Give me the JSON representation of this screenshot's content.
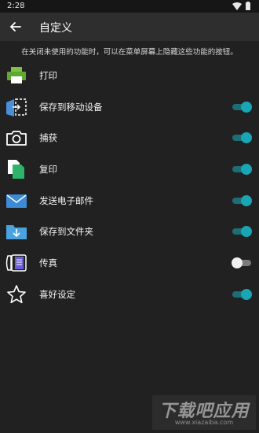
{
  "status_bar": {
    "time": "2:28"
  },
  "app_bar": {
    "title": "自定义"
  },
  "description": "在关闭未使用的功能时，可以在菜单屏幕上隐藏这些功能的按钮。",
  "items": [
    {
      "label": "打印",
      "icon": "printer-icon",
      "toggle": null
    },
    {
      "label": "保存到移动设备",
      "icon": "save-to-device-icon",
      "toggle": "on"
    },
    {
      "label": "捕获",
      "icon": "camera-icon",
      "toggle": "on"
    },
    {
      "label": "复印",
      "icon": "copy-icon",
      "toggle": "on"
    },
    {
      "label": "发送电子邮件",
      "icon": "email-icon",
      "toggle": "on"
    },
    {
      "label": "保存到文件夹",
      "icon": "folder-save-icon",
      "toggle": "on"
    },
    {
      "label": "传真",
      "icon": "fax-icon",
      "toggle": "off"
    },
    {
      "label": "喜好设定",
      "icon": "star-icon",
      "toggle": "on"
    }
  ],
  "watermark": {
    "title": "下载吧应用",
    "url": "www.xiazaiba.com"
  },
  "colors": {
    "accent": "#1aa5b4",
    "background": "#212121",
    "appbar": "#2e2e2e"
  }
}
